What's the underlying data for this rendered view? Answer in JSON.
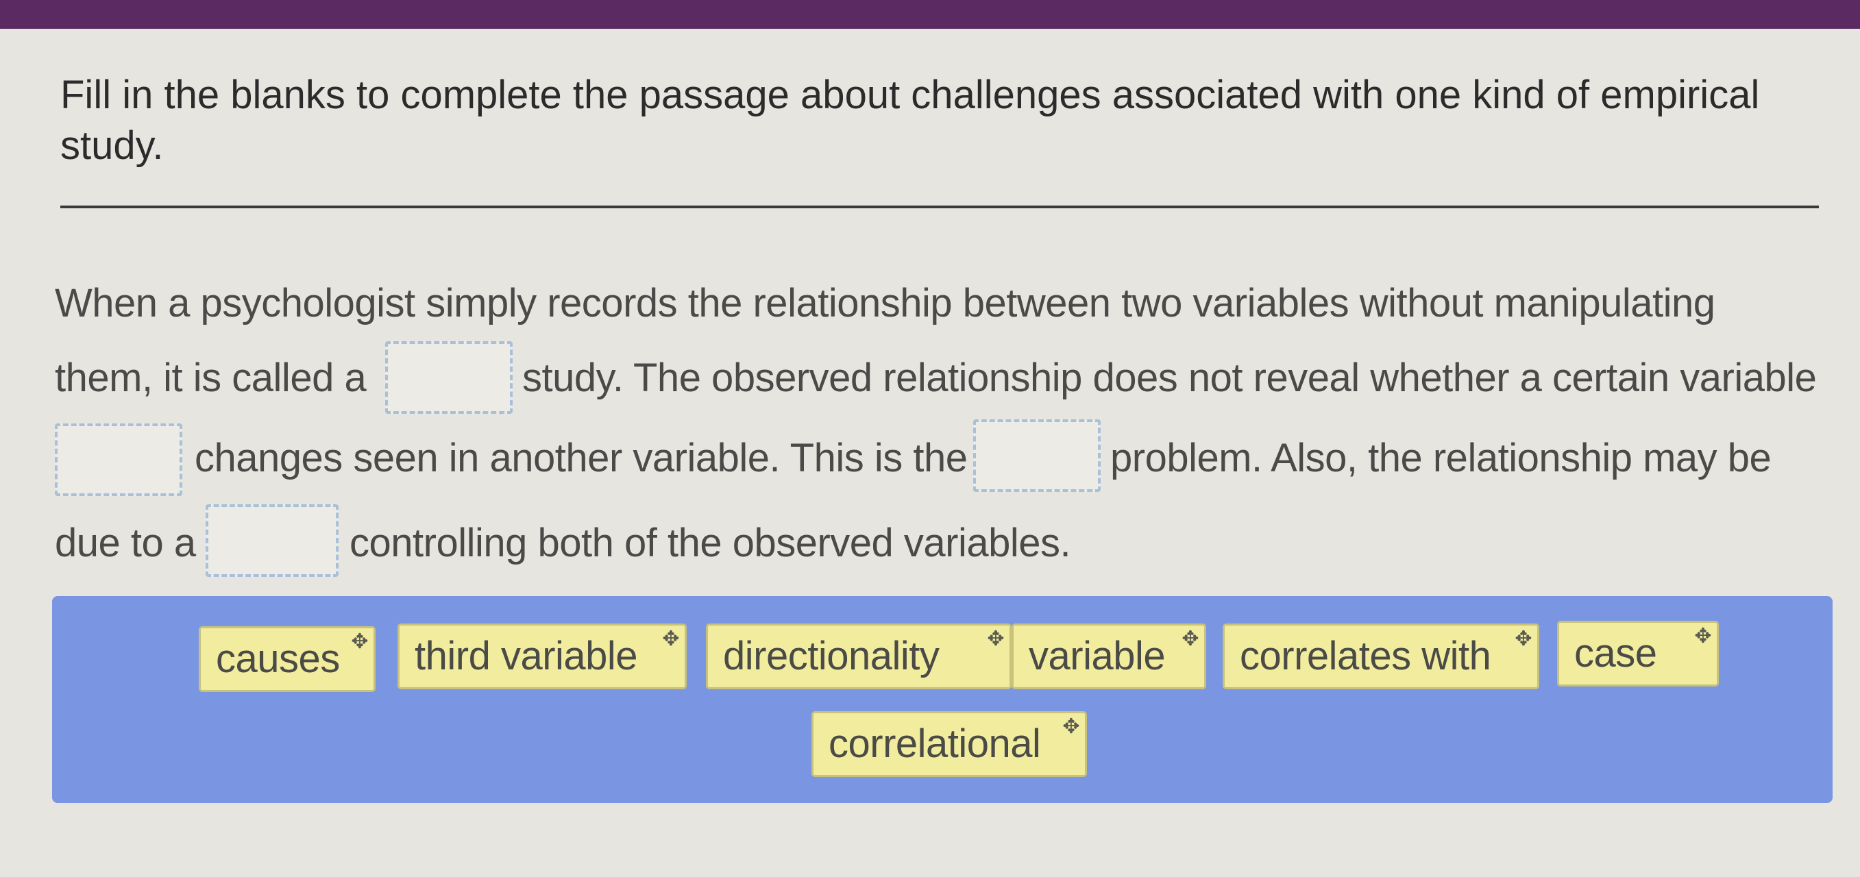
{
  "header": {
    "bar_color": "#5b2a63"
  },
  "question": {
    "prompt": "Fill in the blanks to complete the passage about challenges associated with one kind of empirical study."
  },
  "passage": {
    "line1": "When a psychologist simply records the relationship between two variables without manipulating",
    "line2_a": "them, it is called a",
    "line2_b": "study. The observed relationship does not reveal whether a certain variable",
    "line3_a": "changes seen in another variable. This is the",
    "line3_b": "problem. Also, the relationship may be",
    "line4_a": "due to a",
    "line4_b": "controlling both of the observed variables."
  },
  "blanks": [
    "",
    "",
    "",
    ""
  ],
  "word_bank": {
    "background_color": "#7a95e2",
    "chip_color": "#f1ec9e",
    "move_icon": "move-icon",
    "items": [
      "causes",
      "third variable",
      "directionality",
      "variable",
      "correlates with",
      "case",
      "correlational"
    ]
  }
}
